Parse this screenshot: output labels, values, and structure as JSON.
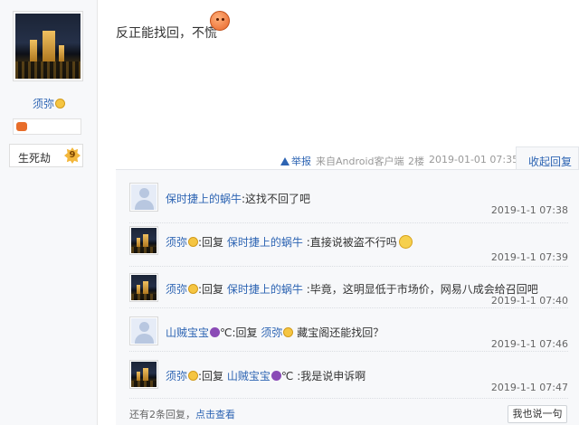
{
  "author": {
    "username": "须弥",
    "level_name": "生死劫",
    "level_num": "9"
  },
  "post": {
    "text": "反正能找回，不慌",
    "report_label": "举报",
    "source": "来自Android客户端",
    "floor": "2楼",
    "time": "2019-01-01 07:35",
    "collapse_label": "收起回复"
  },
  "replies": [
    {
      "avatar": "default-avatar",
      "user": "保时捷上的蜗牛",
      "reply_prefix": "",
      "reply_to": "",
      "text": ":这找不回了吧",
      "time": "2019-1-1 07:38"
    },
    {
      "avatar": "night-city-avatar",
      "user": "须弥",
      "reply_prefix": ":回复 ",
      "reply_to": "保时捷上的蜗牛",
      "text": " :直接说被盗不行吗",
      "time": "2019-1-1 07:39"
    },
    {
      "avatar": "night-city-avatar",
      "user": "须弥",
      "reply_prefix": ":回复 ",
      "reply_to": "保时捷上的蜗牛",
      "text": " :毕竟，这明显低于市场价，网易八成会给召回吧",
      "time": "2019-1-1 07:40"
    },
    {
      "avatar": "default-avatar",
      "user": "山贼宝宝",
      "user_suffix": "℃",
      "reply_prefix": ":回复 ",
      "reply_to": "须弥",
      "text": " 藏宝阁还能找回？",
      "time": "2019-1-1 07:46"
    },
    {
      "avatar": "night-city-avatar",
      "user": "须弥",
      "reply_prefix": ":回复 ",
      "reply_to": "山贼宝宝",
      "reply_to_suffix": "℃",
      "text": " :我是说申诉啊",
      "time": "2019-1-1 07:47"
    }
  ],
  "footer": {
    "more_text": "还有2条回复，",
    "view_link": "点击查看",
    "say_button": "我也说一句"
  }
}
